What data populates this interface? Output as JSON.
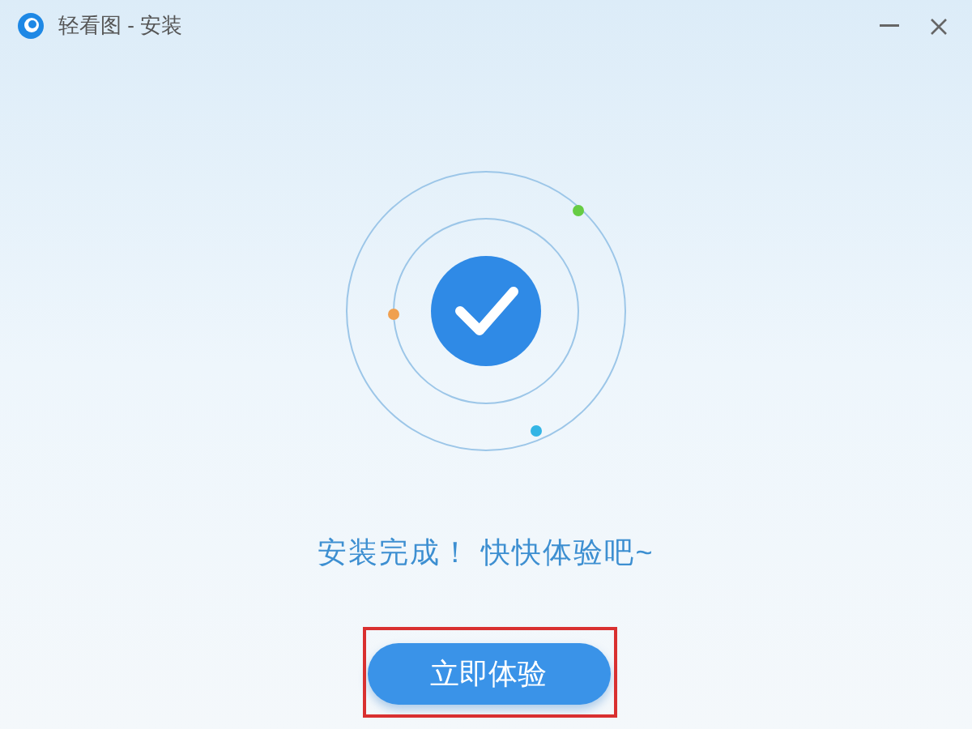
{
  "window": {
    "title": "轻看图 - 安装"
  },
  "message": "安装完成！ 快快体验吧~",
  "primary_button": {
    "label": "立即体验",
    "highlighted": true
  }
}
